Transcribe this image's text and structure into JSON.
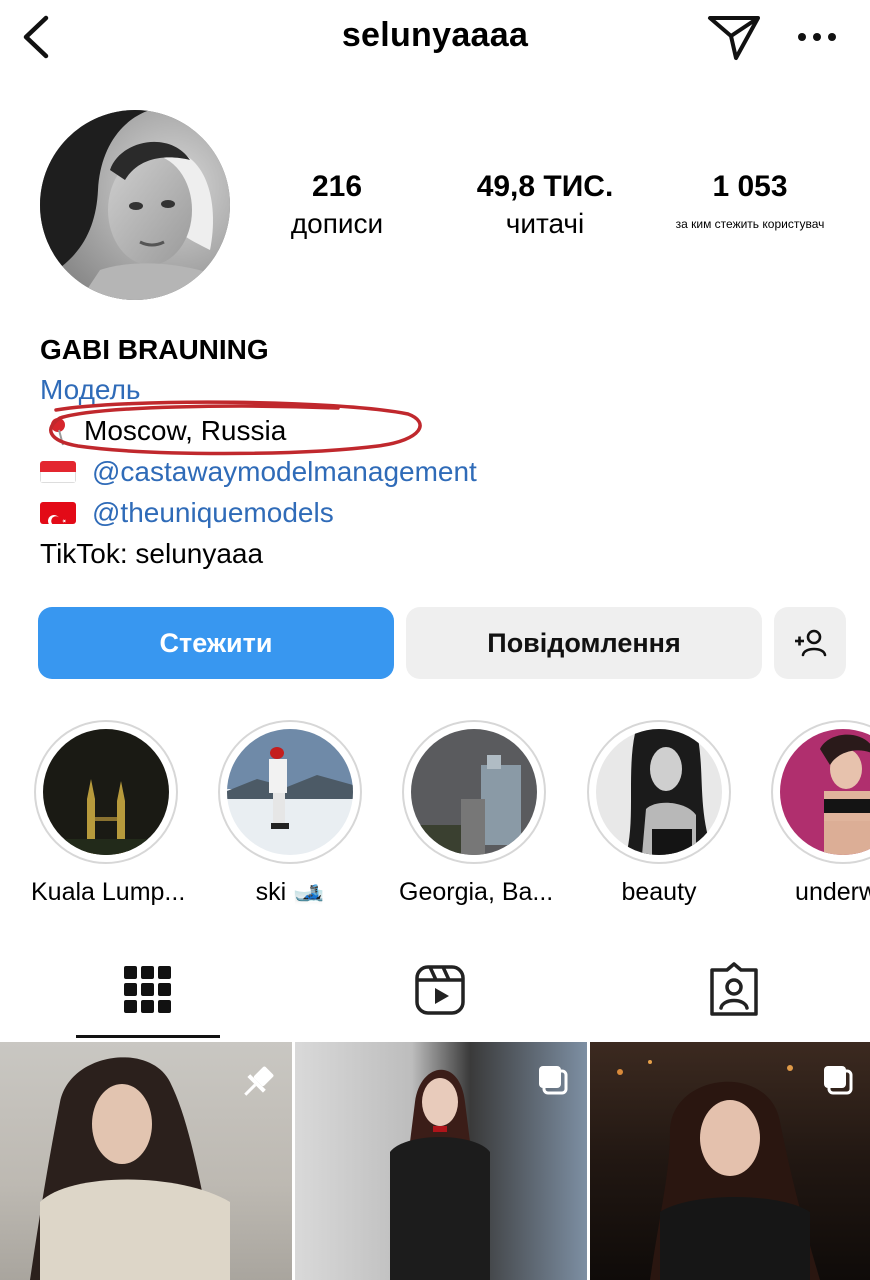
{
  "header": {
    "username": "selunyaaaa",
    "back_icon": "chevron-left-icon",
    "send_icon": "paper-plane-icon",
    "more_icon": "more-horizontal-icon"
  },
  "stats": {
    "posts": {
      "value": "216",
      "label": "дописи"
    },
    "followers": {
      "value": "49,8 ТИС.",
      "label": "читачі"
    },
    "following": {
      "value": "1 053",
      "label": "за ким стежить користувач"
    }
  },
  "bio": {
    "name": "GABI BRAUNING",
    "category": "Модель",
    "location": "Moscow, Russia",
    "agency_1": "@castawaymodelmanagement",
    "agency_2": "@theuniquemodels",
    "tiktok": "TikTok: selunyaaa"
  },
  "buttons": {
    "follow": "Стежити",
    "message": "Повідомлення",
    "add_user_icon": "add-user-icon"
  },
  "highlights": [
    {
      "label": "Kuala Lump..."
    },
    {
      "label": "ski 🎿"
    },
    {
      "label": "Georgia, Ba..."
    },
    {
      "label": "beauty"
    },
    {
      "label": "underwe"
    }
  ],
  "tabs": [
    {
      "icon": "grid-icon",
      "active": true
    },
    {
      "icon": "reels-icon",
      "active": false
    },
    {
      "icon": "tagged-icon",
      "active": false
    }
  ],
  "colors": {
    "accent": "#3897f0",
    "link": "#2f6bb8",
    "annotation": "#c0282d"
  }
}
